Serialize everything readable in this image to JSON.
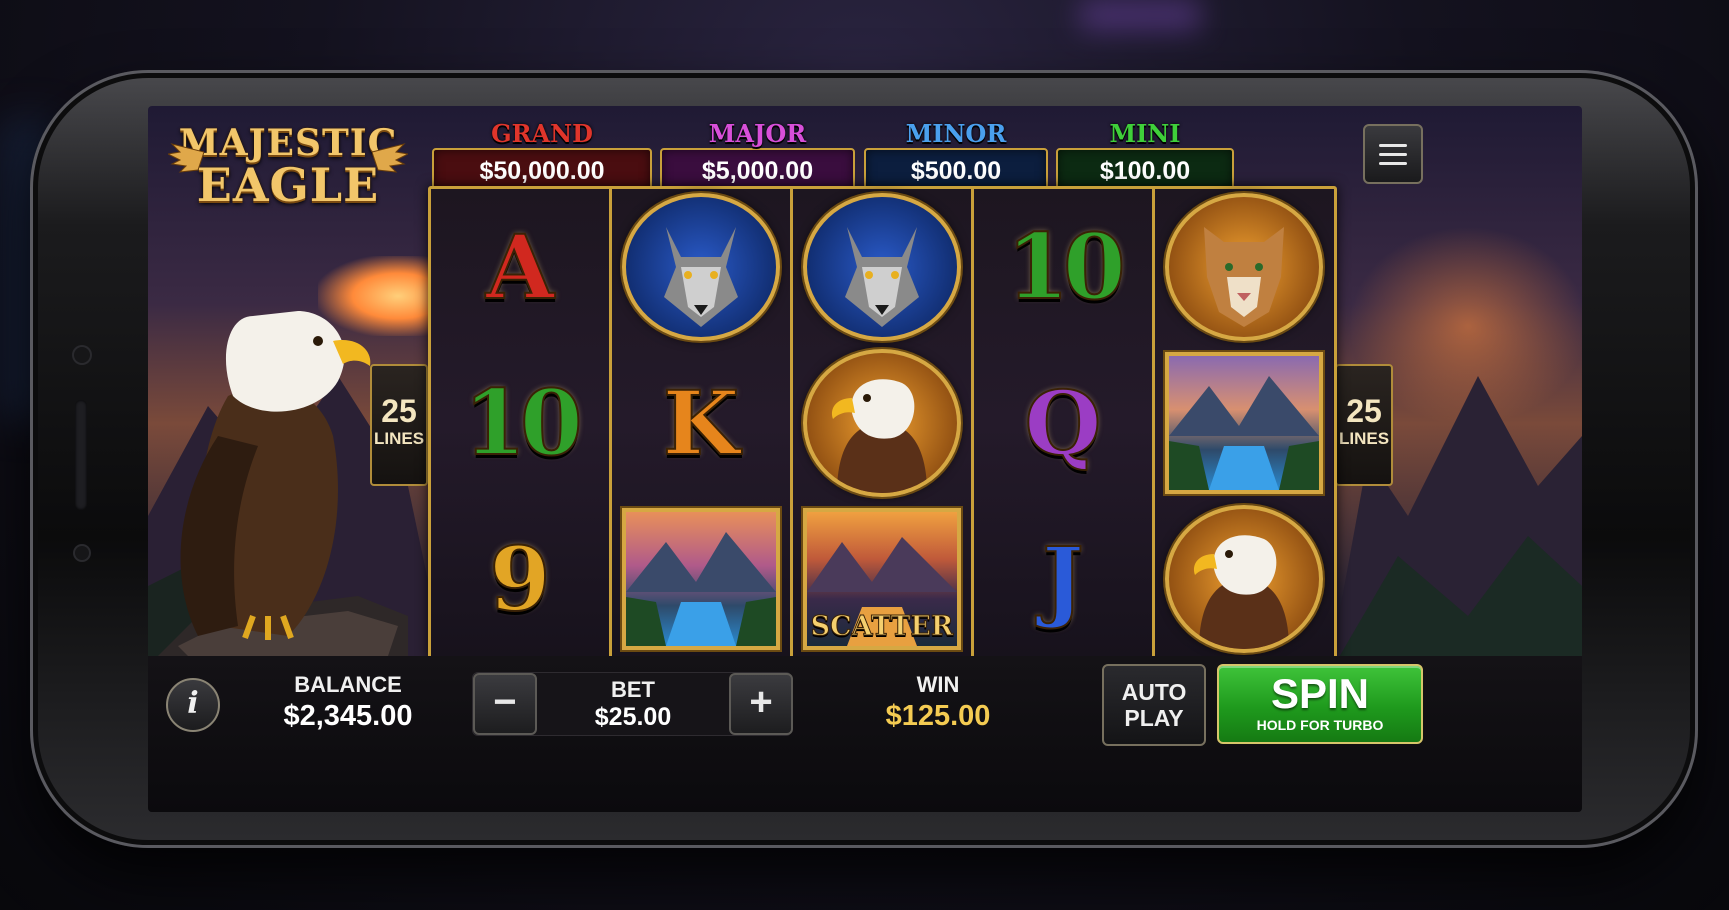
{
  "game": {
    "title_line1": "MAJESTIC",
    "title_line2": "EAGLE"
  },
  "jackpots": [
    {
      "label": "GRAND",
      "amount": "$50,000.00",
      "label_color": "#e0352b",
      "box_color": "#4a0d10"
    },
    {
      "label": "MAJOR",
      "amount": "$5,000.00",
      "label_color": "#d84fd9",
      "box_color": "#3a0d3e"
    },
    {
      "label": "MINOR",
      "amount": "$500.00",
      "label_color": "#4aa0ee",
      "box_color": "#0c1e3e"
    },
    {
      "label": "MINI",
      "amount": "$100.00",
      "label_color": "#3fcf3a",
      "box_color": "#0c2a12"
    }
  ],
  "lines": {
    "count": "25",
    "label": "LINES"
  },
  "reels": [
    [
      {
        "symbol": "A",
        "kind": "letter",
        "color": "#d1281f"
      },
      {
        "symbol": "10",
        "kind": "letter",
        "color": "#2fa02a"
      },
      {
        "symbol": "9",
        "kind": "letter",
        "color": "#e2a525"
      }
    ],
    [
      {
        "symbol": "wolf",
        "kind": "icon"
      },
      {
        "symbol": "K",
        "kind": "letter",
        "color": "#e6851c"
      },
      {
        "symbol": "mountain-lake",
        "kind": "tile"
      }
    ],
    [
      {
        "symbol": "wolf",
        "kind": "icon"
      },
      {
        "symbol": "eagle",
        "kind": "icon"
      },
      {
        "symbol": "scatter",
        "kind": "tile",
        "text": "SCATTER"
      }
    ],
    [
      {
        "symbol": "10",
        "kind": "letter",
        "color": "#2fa02a"
      },
      {
        "symbol": "Q",
        "kind": "letter",
        "color": "#9b3dc4"
      },
      {
        "symbol": "J",
        "kind": "letter",
        "color": "#2a5ad8"
      }
    ],
    [
      {
        "symbol": "cougar",
        "kind": "icon"
      },
      {
        "symbol": "mountain-lake",
        "kind": "tile"
      },
      {
        "symbol": "eagle",
        "kind": "icon"
      }
    ]
  ],
  "bottom": {
    "balance_label": "BALANCE",
    "balance_value": "$2,345.00",
    "bet_label": "BET",
    "bet_value": "$25.00",
    "bet_minus": "−",
    "bet_plus": "+",
    "win_label": "WIN",
    "win_value": "$125.00",
    "auto_line1": "AUTO",
    "auto_line2": "PLAY",
    "spin_label": "SPIN",
    "spin_sub": "HOLD FOR TURBO",
    "info_label": "i"
  },
  "colors": {
    "gold_frame": "#c9a03a",
    "win": "#f4cb52",
    "spin_green": "#1f9a1d"
  }
}
